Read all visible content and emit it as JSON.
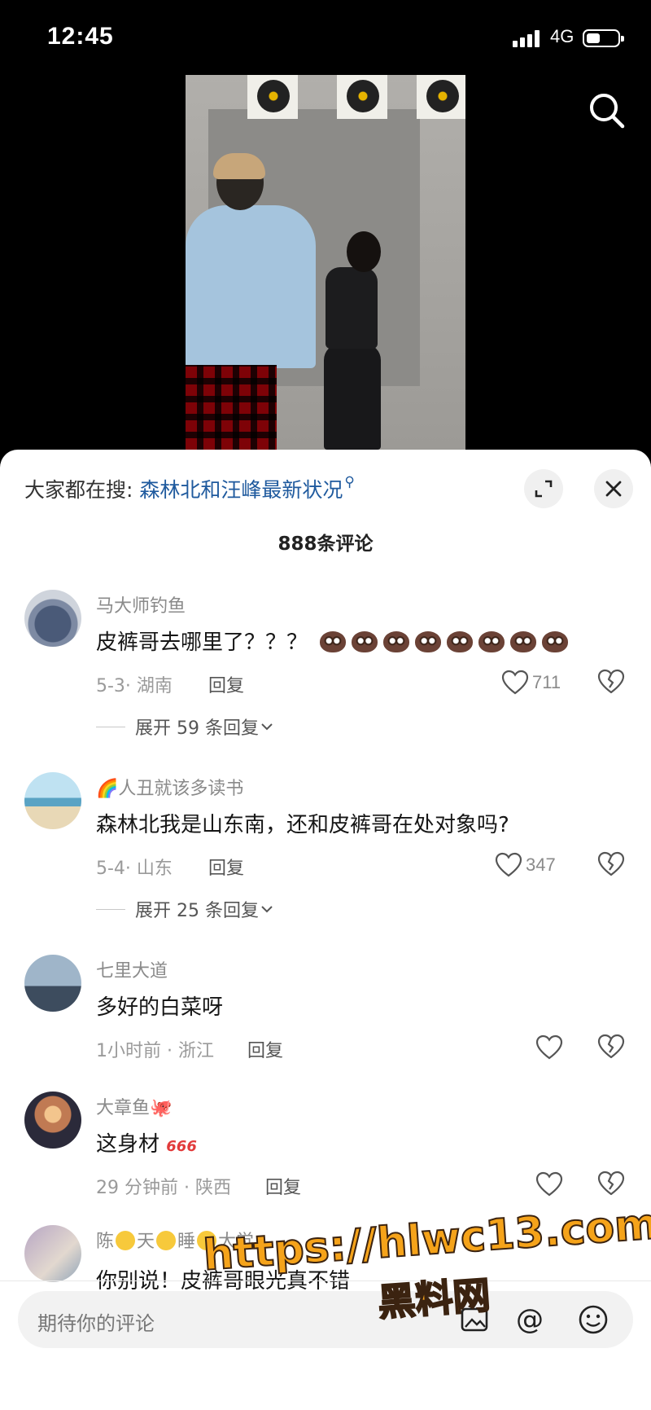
{
  "status_bar": {
    "time": "12:45",
    "network": "4G"
  },
  "header": {
    "search_icon": "search-icon"
  },
  "panel": {
    "trending_prefix": "大家都在搜:",
    "trending_query": "森林北和汪峰最新状况",
    "expand_icon": "expand-icon",
    "close_icon": "close-icon",
    "comment_count": "888条评论"
  },
  "comments": [
    {
      "username": "马大师钓鱼",
      "text": "皮裤哥去哪里了？？？",
      "emoji_count": 8,
      "meta": "5-3· 湖南",
      "reply": "回复",
      "likes": "711",
      "expand": "展开 59 条回复"
    },
    {
      "username_emoji": "🌈",
      "username": "人丑就该多读书",
      "text": "森林北我是山东南，还和皮裤哥在处对象吗?",
      "meta": "5-4· 山东",
      "reply": "回复",
      "likes": "347",
      "expand": "展开 25 条回复"
    },
    {
      "username": "七里大道",
      "text": "多好的白菜呀",
      "meta": "1小时前 · 浙江",
      "reply": "回复",
      "likes": ""
    },
    {
      "username": "大章鱼",
      "username_emoji": "🐙",
      "text": "这身材",
      "text_emoji": "666",
      "meta": "29 分钟前 · 陕西",
      "reply": "回复",
      "likes": ""
    },
    {
      "username_parts": [
        "陈",
        "天",
        "睡",
        "大觉"
      ],
      "text": "你别说！皮裤哥眼光真不错"
    }
  ],
  "input": {
    "placeholder": "期待你的评论",
    "at_symbol": "@"
  },
  "watermark": {
    "url": "https://hlwc13.com",
    "site": "黑料网"
  },
  "colors": {
    "link": "#1f5a9e",
    "watermark": "#f5a31a"
  }
}
